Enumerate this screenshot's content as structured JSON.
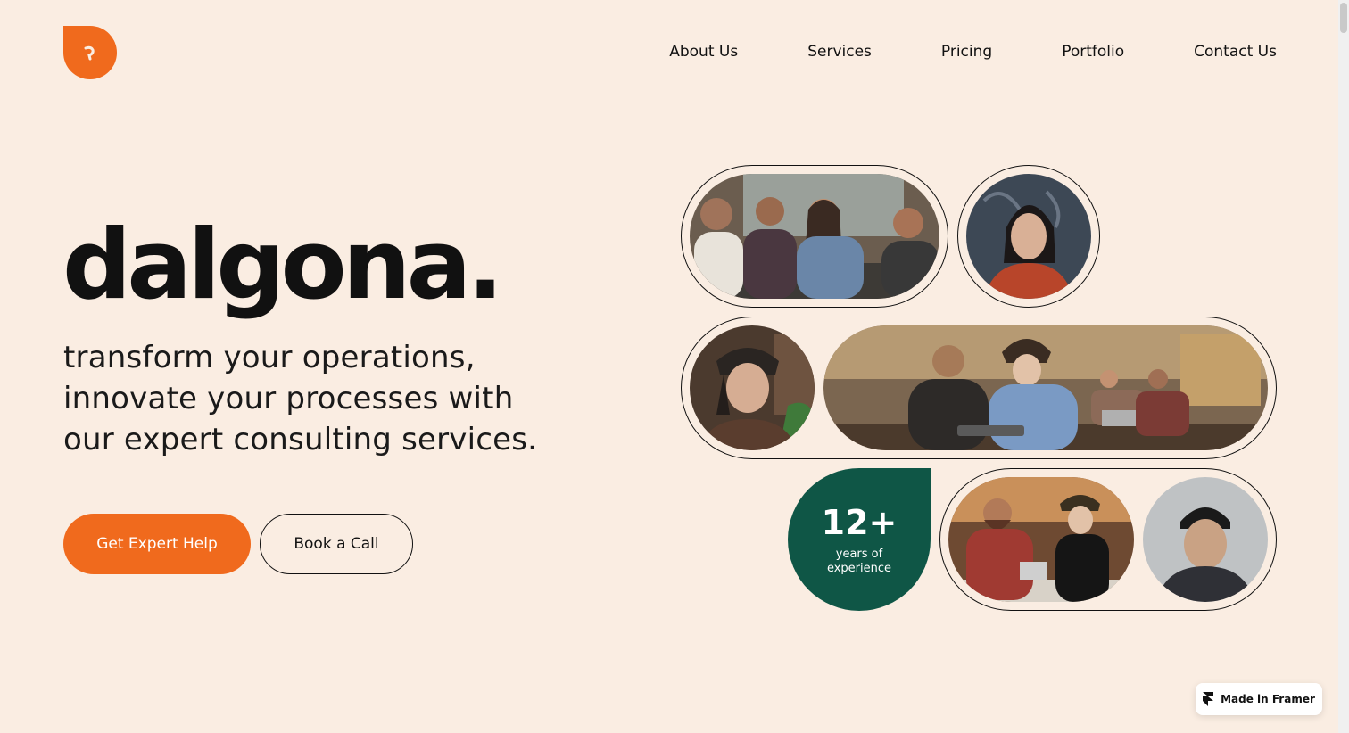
{
  "brand": {
    "name": "dalgona.",
    "logo_color": "#f06a1d"
  },
  "nav": {
    "items": [
      "About Us",
      "Services",
      "Pricing",
      "Portfolio",
      "Contact Us"
    ]
  },
  "hero": {
    "tagline_lines": [
      "transform your operations,",
      "innovate your processes with",
      "our expert consulting services."
    ],
    "primary_button": "Get Expert Help",
    "secondary_button": "Book a Call"
  },
  "stat": {
    "value": "12+",
    "label_lines": [
      "years of",
      "experience"
    ],
    "color": "#0f5646"
  },
  "photos": [
    {
      "icon": "team-meeting-photo"
    },
    {
      "icon": "portrait-woman-photo"
    },
    {
      "icon": "portrait-woman-cap-photo"
    },
    {
      "icon": "cafe-work-photo"
    },
    {
      "icon": "cafe-discussion-photo"
    },
    {
      "icon": "portrait-man-beanie-photo"
    }
  ],
  "badge": {
    "label": "Made in Framer"
  },
  "colors": {
    "background": "#faede2",
    "accent": "#f06a1d",
    "dark": "#111111"
  }
}
